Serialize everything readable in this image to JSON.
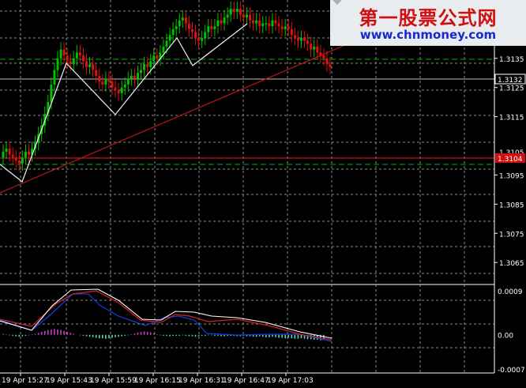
{
  "watermark": {
    "title": "第一股票公式网",
    "url": "www.chnmoney.com"
  },
  "colors": {
    "bull": "#00c000",
    "bear": "#e01010",
    "grid": "#8a8a8a",
    "axis": "#ffffff",
    "trend": "#c01818",
    "zigzag": "#f2f2f2",
    "hline_green": "#00b000",
    "hline_red": "#d01010",
    "macd_pos": "#c040c0",
    "macd_neg": "#60d0c0",
    "signal": "#1040e0",
    "fast": "#ffffff",
    "slow": "#d82020"
  },
  "main_chart": {
    "price_labels": [
      "1.3135",
      "1.3125",
      "1.3115",
      "1.3095",
      "1.3085",
      "1.3075",
      "1.3065"
    ],
    "price_label_values": [
      1.3135,
      1.3125,
      1.3115,
      1.3095,
      1.3085,
      1.3075,
      1.3065
    ],
    "partial_label": "1.3105",
    "current_price": "1.3132",
    "red_level": "1.3104",
    "green_dashed_levels": [
      1.314,
      1.3102
    ],
    "price_range": [
      1.3058,
      1.3155
    ]
  },
  "indicator": {
    "labels": [
      "0.0009",
      "0.00",
      "-0.0007"
    ],
    "label_values": [
      0.0009,
      0.0,
      -0.0007
    ],
    "range": [
      -0.00075,
      0.001
    ]
  },
  "time_labels": [
    "19 Apr 15:27",
    "19 Apr 15:43",
    "19 Apr 15:59",
    "19 Apr 16:15",
    "19 Apr 16:31",
    "19 Apr 16:47",
    "19 Apr 17:03"
  ],
  "chart_data": {
    "type": "candlestick",
    "x_labels": [
      "19 Apr 15:27",
      "19 Apr 15:43",
      "19 Apr 15:59",
      "19 Apr 16:15",
      "19 Apr 16:31",
      "19 Apr 16:47",
      "19 Apr 17:03"
    ],
    "closes": [
      1.3103,
      1.3104,
      1.3102,
      1.3101,
      1.31,
      1.3099,
      1.3101,
      1.3103,
      1.3102,
      1.3104,
      1.3106,
      1.3109,
      1.3112,
      1.3116,
      1.312,
      1.3126,
      1.3131,
      1.3135,
      1.3138,
      1.3136,
      1.3134,
      1.3133,
      1.3135,
      1.3137,
      1.3136,
      1.3134,
      1.3132,
      1.3133,
      1.3131,
      1.3129,
      1.3127,
      1.3126,
      1.3128,
      1.3127,
      1.3125,
      1.3124,
      1.3123,
      1.3125,
      1.3126,
      1.3128,
      1.3129,
      1.3128,
      1.313,
      1.3131,
      1.3133,
      1.3132,
      1.3134,
      1.3136,
      1.3135,
      1.3137,
      1.3139,
      1.3141,
      1.3143,
      1.3145,
      1.3146,
      1.3148,
      1.3149,
      1.3147,
      1.3145,
      1.3144,
      1.3142,
      1.3141,
      1.3142,
      1.3144,
      1.3146,
      1.3145,
      1.3146,
      1.3148,
      1.3147,
      1.3149,
      1.315,
      1.3152,
      1.3151,
      1.3152,
      1.315,
      1.3149,
      1.315,
      1.3148,
      1.3147,
      1.3148,
      1.3146,
      1.3147,
      1.3147,
      1.3146,
      1.3148,
      1.3147,
      1.3146,
      1.3145,
      1.3146,
      1.3145,
      1.3143,
      1.3142,
      1.3141,
      1.3142,
      1.3141,
      1.314,
      1.3138,
      1.3139,
      1.3137,
      1.3136,
      1.3135,
      1.3133,
      1.3132
    ],
    "macd_hist": [
      2e-05,
      1e-05,
      -1e-05,
      -2e-05,
      -3e-05,
      -4e-05,
      -3e-05,
      -2e-05,
      -1e-05,
      1e-05,
      2e-05,
      4e-05,
      6e-05,
      8e-05,
      0.0001,
      0.00011,
      0.00012,
      0.00011,
      0.0001,
      8e-05,
      6e-05,
      4e-05,
      2e-05,
      0.0,
      -1e-05,
      -2e-05,
      -3e-05,
      -4e-05,
      -5e-05,
      -6e-05,
      -7e-05,
      -7e-05,
      -8e-05,
      -7e-05,
      -6e-05,
      -5e-05,
      -4e-05,
      -3e-05,
      -2e-05,
      -1e-05,
      1e-05,
      3e-05,
      5e-05,
      6e-05,
      7e-05,
      6e-05,
      5e-05,
      3e-05,
      1e-05,
      -1e-05,
      -2e-05,
      -2e-05,
      -3e-05,
      -2e-05,
      -2e-05,
      -2e-05,
      -1e-05,
      -2e-05,
      -3e-05,
      -3e-05,
      -4e-05,
      -3e-05,
      -2e-05,
      -2e-05,
      -1e-05,
      -1e-05,
      -2e-05,
      -2e-05,
      -3e-05,
      -3e-05,
      -2e-05,
      -2e-05,
      -2e-05,
      -3e-05,
      -3e-05,
      -2e-05,
      -3e-05,
      -3e-05,
      -4e-05,
      -4e-05,
      -3e-05,
      -4e-05,
      -5e-05,
      -5e-05,
      -4e-05,
      -5e-05,
      -6e-05,
      -6e-05,
      -7e-05,
      -6e-05,
      -7e-05,
      -8e-05,
      -8e-05,
      -7e-05,
      -8e-05,
      -9e-05,
      -9e-05,
      -0.0001,
      -0.0001,
      -0.00011,
      -0.0001
    ]
  }
}
